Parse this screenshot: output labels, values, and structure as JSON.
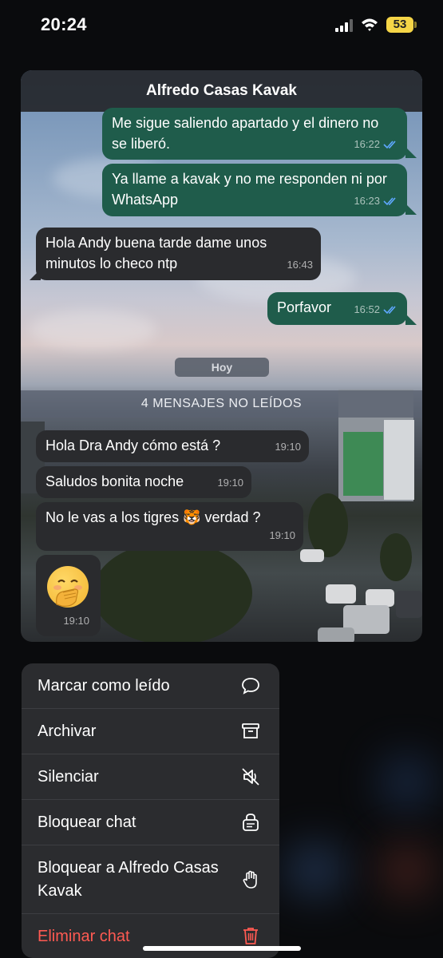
{
  "status_bar": {
    "time": "20:24",
    "battery": "53"
  },
  "chat": {
    "title": "Alfredo Casas Kavak",
    "day_label": "Hoy",
    "unread_banner": "4 MENSAJES NO LEÍDOS",
    "messages": [
      {
        "direction": "out",
        "text": "Me sigue saliendo apartado y el dinero no se liberó.",
        "time": "16:22",
        "read": true
      },
      {
        "direction": "out",
        "text": "Ya llame a kavak y no me responden ni por WhatsApp",
        "time": "16:23",
        "read": true
      },
      {
        "direction": "in",
        "text": "Hola Andy buena tarde dame unos minutos lo checo ntp",
        "time": "16:43"
      },
      {
        "direction": "out",
        "text": "Porfavor",
        "time": "16:52",
        "read": true
      },
      {
        "direction": "in",
        "text": "Hola Dra Andy cómo está ?",
        "time": "19:10"
      },
      {
        "direction": "in",
        "text": "Saludos bonita noche",
        "time": "19:10"
      },
      {
        "direction": "in",
        "text": "No le vas a los tigres 🐯 verdad ?",
        "time": "19:10"
      },
      {
        "direction": "in",
        "text": "🤭",
        "time": "19:10"
      }
    ]
  },
  "menu": {
    "items": [
      {
        "label": "Marcar como leído",
        "icon": "speech-bubble-icon"
      },
      {
        "label": "Archivar",
        "icon": "archive-box-icon"
      },
      {
        "label": "Silenciar",
        "icon": "muted-speaker-icon"
      },
      {
        "label": "Bloquear chat",
        "icon": "locked-chat-icon"
      },
      {
        "label": "Bloquear a Alfredo Casas Kavak",
        "icon": "raised-hand-icon"
      },
      {
        "label": "Eliminar chat",
        "icon": "trash-icon",
        "destructive": true
      }
    ]
  },
  "colors": {
    "outgoing_bubble": "#1f5c4b",
    "incoming_bubble": "#2a2b2e",
    "read_ticks": "#5fa8ff",
    "destructive": "#ff5a52",
    "battery": "#f5d547"
  }
}
